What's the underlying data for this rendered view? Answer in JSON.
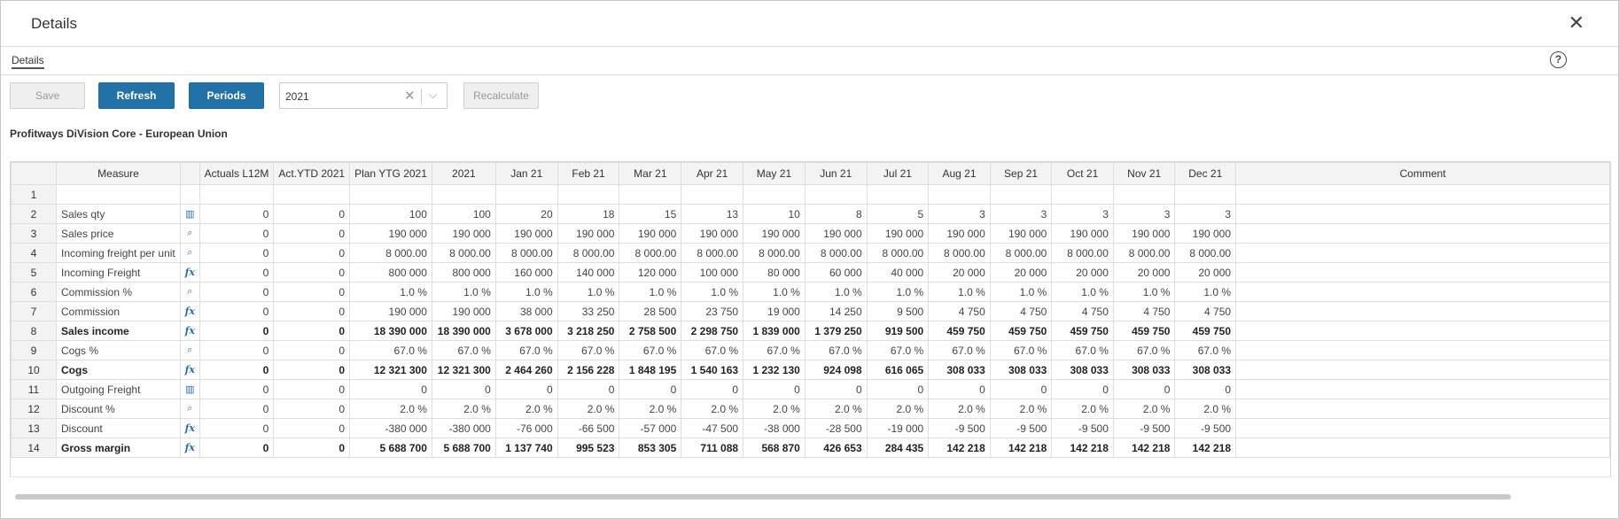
{
  "dialog": {
    "title": "Details",
    "close_glyph": "✕"
  },
  "tabs": [
    {
      "label": "Details"
    }
  ],
  "help": {
    "glyph": "?"
  },
  "toolbar": {
    "save_label": "Save",
    "refresh_label": "Refresh",
    "periods_label": "Periods",
    "period_value": "2021",
    "recalculate_label": "Recalculate"
  },
  "subtitle": "Profitways DiVision Core - European Union",
  "table": {
    "headers": [
      "Measure",
      "",
      "Actuals L12M",
      "Act.YTD 2021",
      "Plan YTG 2021",
      "2021",
      "Jan 21",
      "Feb 21",
      "Mar 21",
      "Apr 21",
      "May 21",
      "Jun 21",
      "Jul 21",
      "Aug 21",
      "Sep 21",
      "Oct 21",
      "Nov 21",
      "Dec 21",
      "Comment"
    ],
    "rows": [
      {
        "n": "1",
        "label": "",
        "icon": "",
        "bold": false,
        "values": [
          "",
          "",
          "",
          "",
          "",
          "",
          "",
          "",
          "",
          "",
          "",
          "",
          "",
          "",
          "",
          ""
        ]
      },
      {
        "n": "2",
        "label": "Sales qty",
        "icon": "bar-chart-icon",
        "bold": false,
        "values": [
          "0",
          "0",
          "100",
          "100",
          "20",
          "18",
          "15",
          "13",
          "10",
          "8",
          "5",
          "3",
          "3",
          "3",
          "3",
          "3"
        ]
      },
      {
        "n": "3",
        "label": "Sales price",
        "icon": "search-doc-icon",
        "bold": false,
        "values": [
          "0",
          "0",
          "190 000",
          "190 000",
          "190 000",
          "190 000",
          "190 000",
          "190 000",
          "190 000",
          "190 000",
          "190 000",
          "190 000",
          "190 000",
          "190 000",
          "190 000",
          "190 000"
        ]
      },
      {
        "n": "4",
        "label": "Incoming freight per unit",
        "icon": "search-doc-icon",
        "bold": false,
        "values": [
          "0",
          "0",
          "8 000.00",
          "8 000.00",
          "8 000.00",
          "8 000.00",
          "8 000.00",
          "8 000.00",
          "8 000.00",
          "8 000.00",
          "8 000.00",
          "8 000.00",
          "8 000.00",
          "8 000.00",
          "8 000.00",
          "8 000.00"
        ]
      },
      {
        "n": "5",
        "label": "Incoming Freight",
        "icon": "fx-icon",
        "bold": false,
        "values": [
          "0",
          "0",
          "800 000",
          "800 000",
          "160 000",
          "140 000",
          "120 000",
          "100 000",
          "80 000",
          "60 000",
          "40 000",
          "20 000",
          "20 000",
          "20 000",
          "20 000",
          "20 000"
        ]
      },
      {
        "n": "6",
        "label": "Commission %",
        "icon": "search-doc-icon",
        "bold": false,
        "values": [
          "0",
          "0",
          "1.0 %",
          "1.0 %",
          "1.0 %",
          "1.0 %",
          "1.0 %",
          "1.0 %",
          "1.0 %",
          "1.0 %",
          "1.0 %",
          "1.0 %",
          "1.0 %",
          "1.0 %",
          "1.0 %",
          "1.0 %"
        ]
      },
      {
        "n": "7",
        "label": "Commission",
        "icon": "fx-icon",
        "bold": false,
        "values": [
          "0",
          "0",
          "190 000",
          "190 000",
          "38 000",
          "33 250",
          "28 500",
          "23 750",
          "19 000",
          "14 250",
          "9 500",
          "4 750",
          "4 750",
          "4 750",
          "4 750",
          "4 750"
        ]
      },
      {
        "n": "8",
        "label": "Sales income",
        "icon": "fx-icon",
        "bold": true,
        "values": [
          "0",
          "0",
          "18 390 000",
          "18 390 000",
          "3 678 000",
          "3 218 250",
          "2 758 500",
          "2 298 750",
          "1 839 000",
          "1 379 250",
          "919 500",
          "459 750",
          "459 750",
          "459 750",
          "459 750",
          "459 750"
        ]
      },
      {
        "n": "9",
        "label": "Cogs %",
        "icon": "search-doc-icon",
        "bold": false,
        "values": [
          "0",
          "0",
          "67.0 %",
          "67.0 %",
          "67.0 %",
          "67.0 %",
          "67.0 %",
          "67.0 %",
          "67.0 %",
          "67.0 %",
          "67.0 %",
          "67.0 %",
          "67.0 %",
          "67.0 %",
          "67.0 %",
          "67.0 %"
        ]
      },
      {
        "n": "10",
        "label": "Cogs",
        "icon": "fx-icon",
        "bold": true,
        "values": [
          "0",
          "0",
          "12 321 300",
          "12 321 300",
          "2 464 260",
          "2 156 228",
          "1 848 195",
          "1 540 163",
          "1 232 130",
          "924 098",
          "616 065",
          "308 033",
          "308 033",
          "308 033",
          "308 033",
          "308 033"
        ]
      },
      {
        "n": "11",
        "label": "Outgoing Freight",
        "icon": "bar-chart-icon",
        "bold": false,
        "values": [
          "0",
          "0",
          "0",
          "0",
          "0",
          "0",
          "0",
          "0",
          "0",
          "0",
          "0",
          "0",
          "0",
          "0",
          "0",
          "0"
        ]
      },
      {
        "n": "12",
        "label": "Discount %",
        "icon": "search-doc-icon",
        "bold": false,
        "values": [
          "0",
          "0",
          "2.0 %",
          "2.0 %",
          "2.0 %",
          "2.0 %",
          "2.0 %",
          "2.0 %",
          "2.0 %",
          "2.0 %",
          "2.0 %",
          "2.0 %",
          "2.0 %",
          "2.0 %",
          "2.0 %",
          "2.0 %"
        ]
      },
      {
        "n": "13",
        "label": "Discount",
        "icon": "fx-icon",
        "bold": false,
        "values": [
          "0",
          "0",
          "-380 000",
          "-380 000",
          "-76 000",
          "-66 500",
          "-57 000",
          "-47 500",
          "-38 000",
          "-28 500",
          "-19 000",
          "-9 500",
          "-9 500",
          "-9 500",
          "-9 500",
          "-9 500"
        ]
      },
      {
        "n": "14",
        "label": "Gross margin",
        "icon": "fx-icon",
        "bold": true,
        "values": [
          "0",
          "0",
          "5 688 700",
          "5 688 700",
          "1 137 740",
          "995 523",
          "853 305",
          "711 088",
          "568 870",
          "426 653",
          "284 435",
          "142 218",
          "142 218",
          "142 218",
          "142 218",
          "142 218"
        ]
      }
    ]
  }
}
